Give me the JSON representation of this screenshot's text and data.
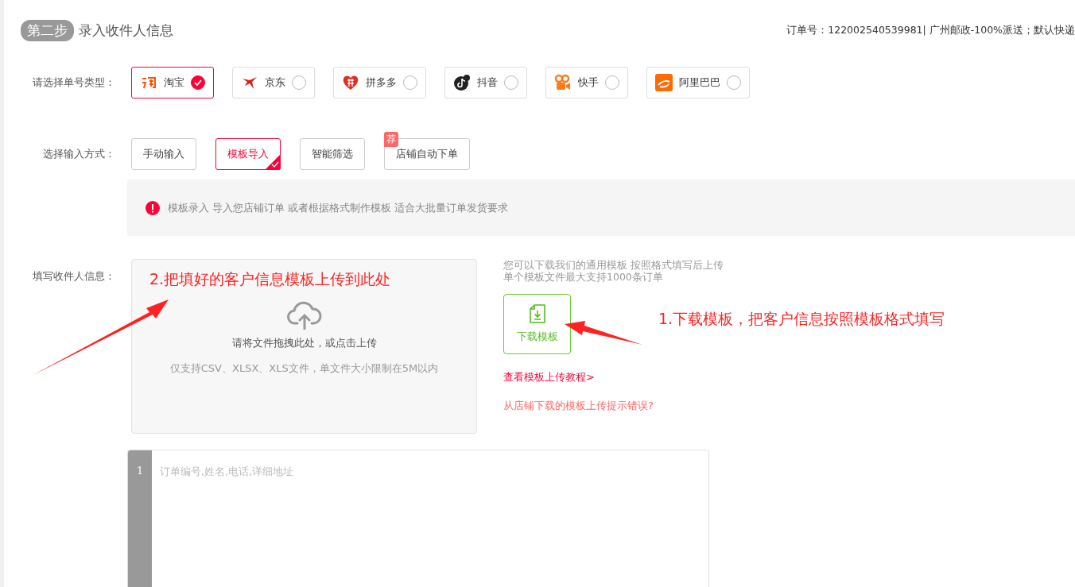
{
  "header": {
    "step_badge": "第二步",
    "title": "录入收件人信息",
    "order_info": "订单号：122002540539981| 广州邮政-100%派送；默认快递"
  },
  "platform_type": {
    "label": "请选择单号类型：",
    "options": [
      {
        "name": "淘宝",
        "selected": true
      },
      {
        "name": "京东",
        "selected": false
      },
      {
        "name": "拼多多",
        "selected": false
      },
      {
        "name": "抖音",
        "selected": false
      },
      {
        "name": "快手",
        "selected": false
      },
      {
        "name": "阿里巴巴",
        "selected": false
      }
    ]
  },
  "input_method": {
    "label": "选择输入方式：",
    "options": [
      {
        "label": "手动输入",
        "selected": false
      },
      {
        "label": "模板导入",
        "selected": true
      },
      {
        "label": "智能筛选",
        "selected": false
      },
      {
        "label": "店铺自动下单",
        "selected": false,
        "badge": "荐"
      }
    ]
  },
  "notice": "模板录入 导入您店铺订单 或者根据格式制作模板 适合大批量订单发货要求",
  "recipient": {
    "label": "填写收件人信息：",
    "upload_prompt": "请将文件拖拽此处，或点击上传",
    "upload_hint": "仅支持CSV、XLSX、XLS文件，单文件大小限制在5M以内",
    "side_hints": [
      "您可以下载我们的通用模板 按照格式填写后上传",
      "单个模板文件最大支持1000条订单"
    ],
    "download_button": "下载模板",
    "tutorial_link": "查看模板上传教程>",
    "error_link": "从店铺下载的模板上传提示错误?"
  },
  "annotations": [
    {
      "text": "2.把填好的客户信息模板上传到此处"
    },
    {
      "text": "1.下载模板，把客户信息按照模板格式填写"
    }
  ],
  "editor": {
    "line_number": "1",
    "placeholder": "订单编号,姓名,电话,详细地址"
  }
}
